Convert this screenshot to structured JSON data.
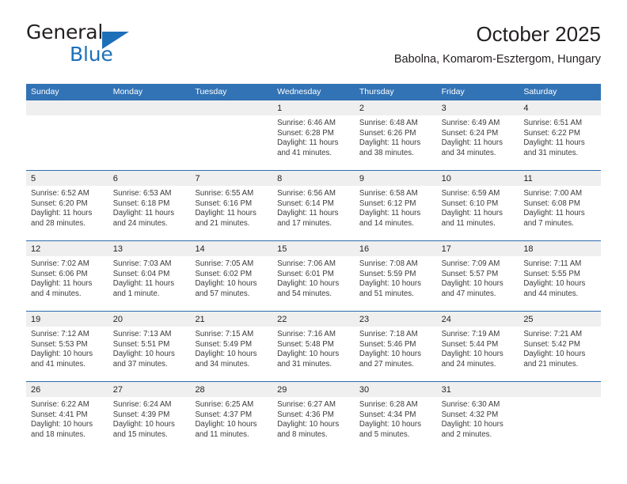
{
  "brand": {
    "name_part1": "General",
    "name_part2": "Blue",
    "triangle_icon": "triangle-icon",
    "accent_color": "#1d70b8"
  },
  "header": {
    "title": "October 2025",
    "subtitle": "Babolna, Komarom-Esztergom, Hungary"
  },
  "theme": {
    "header_blue": "#3273b5",
    "separator_blue": "#2b6cad",
    "band_gray": "#efefef",
    "text": "#231f20"
  },
  "weekdays": [
    "Sunday",
    "Monday",
    "Tuesday",
    "Wednesday",
    "Thursday",
    "Friday",
    "Saturday"
  ],
  "weeks": [
    [
      {
        "day": "",
        "sunrise": "",
        "sunset": "",
        "daylight_1": "",
        "daylight_2": ""
      },
      {
        "day": "",
        "sunrise": "",
        "sunset": "",
        "daylight_1": "",
        "daylight_2": ""
      },
      {
        "day": "",
        "sunrise": "",
        "sunset": "",
        "daylight_1": "",
        "daylight_2": ""
      },
      {
        "day": "1",
        "sunrise": "Sunrise: 6:46 AM",
        "sunset": "Sunset: 6:28 PM",
        "daylight_1": "Daylight: 11 hours",
        "daylight_2": "and 41 minutes."
      },
      {
        "day": "2",
        "sunrise": "Sunrise: 6:48 AM",
        "sunset": "Sunset: 6:26 PM",
        "daylight_1": "Daylight: 11 hours",
        "daylight_2": "and 38 minutes."
      },
      {
        "day": "3",
        "sunrise": "Sunrise: 6:49 AM",
        "sunset": "Sunset: 6:24 PM",
        "daylight_1": "Daylight: 11 hours",
        "daylight_2": "and 34 minutes."
      },
      {
        "day": "4",
        "sunrise": "Sunrise: 6:51 AM",
        "sunset": "Sunset: 6:22 PM",
        "daylight_1": "Daylight: 11 hours",
        "daylight_2": "and 31 minutes."
      }
    ],
    [
      {
        "day": "5",
        "sunrise": "Sunrise: 6:52 AM",
        "sunset": "Sunset: 6:20 PM",
        "daylight_1": "Daylight: 11 hours",
        "daylight_2": "and 28 minutes."
      },
      {
        "day": "6",
        "sunrise": "Sunrise: 6:53 AM",
        "sunset": "Sunset: 6:18 PM",
        "daylight_1": "Daylight: 11 hours",
        "daylight_2": "and 24 minutes."
      },
      {
        "day": "7",
        "sunrise": "Sunrise: 6:55 AM",
        "sunset": "Sunset: 6:16 PM",
        "daylight_1": "Daylight: 11 hours",
        "daylight_2": "and 21 minutes."
      },
      {
        "day": "8",
        "sunrise": "Sunrise: 6:56 AM",
        "sunset": "Sunset: 6:14 PM",
        "daylight_1": "Daylight: 11 hours",
        "daylight_2": "and 17 minutes."
      },
      {
        "day": "9",
        "sunrise": "Sunrise: 6:58 AM",
        "sunset": "Sunset: 6:12 PM",
        "daylight_1": "Daylight: 11 hours",
        "daylight_2": "and 14 minutes."
      },
      {
        "day": "10",
        "sunrise": "Sunrise: 6:59 AM",
        "sunset": "Sunset: 6:10 PM",
        "daylight_1": "Daylight: 11 hours",
        "daylight_2": "and 11 minutes."
      },
      {
        "day": "11",
        "sunrise": "Sunrise: 7:00 AM",
        "sunset": "Sunset: 6:08 PM",
        "daylight_1": "Daylight: 11 hours",
        "daylight_2": "and 7 minutes."
      }
    ],
    [
      {
        "day": "12",
        "sunrise": "Sunrise: 7:02 AM",
        "sunset": "Sunset: 6:06 PM",
        "daylight_1": "Daylight: 11 hours",
        "daylight_2": "and 4 minutes."
      },
      {
        "day": "13",
        "sunrise": "Sunrise: 7:03 AM",
        "sunset": "Sunset: 6:04 PM",
        "daylight_1": "Daylight: 11 hours",
        "daylight_2": "and 1 minute."
      },
      {
        "day": "14",
        "sunrise": "Sunrise: 7:05 AM",
        "sunset": "Sunset: 6:02 PM",
        "daylight_1": "Daylight: 10 hours",
        "daylight_2": "and 57 minutes."
      },
      {
        "day": "15",
        "sunrise": "Sunrise: 7:06 AM",
        "sunset": "Sunset: 6:01 PM",
        "daylight_1": "Daylight: 10 hours",
        "daylight_2": "and 54 minutes."
      },
      {
        "day": "16",
        "sunrise": "Sunrise: 7:08 AM",
        "sunset": "Sunset: 5:59 PM",
        "daylight_1": "Daylight: 10 hours",
        "daylight_2": "and 51 minutes."
      },
      {
        "day": "17",
        "sunrise": "Sunrise: 7:09 AM",
        "sunset": "Sunset: 5:57 PM",
        "daylight_1": "Daylight: 10 hours",
        "daylight_2": "and 47 minutes."
      },
      {
        "day": "18",
        "sunrise": "Sunrise: 7:11 AM",
        "sunset": "Sunset: 5:55 PM",
        "daylight_1": "Daylight: 10 hours",
        "daylight_2": "and 44 minutes."
      }
    ],
    [
      {
        "day": "19",
        "sunrise": "Sunrise: 7:12 AM",
        "sunset": "Sunset: 5:53 PM",
        "daylight_1": "Daylight: 10 hours",
        "daylight_2": "and 41 minutes."
      },
      {
        "day": "20",
        "sunrise": "Sunrise: 7:13 AM",
        "sunset": "Sunset: 5:51 PM",
        "daylight_1": "Daylight: 10 hours",
        "daylight_2": "and 37 minutes."
      },
      {
        "day": "21",
        "sunrise": "Sunrise: 7:15 AM",
        "sunset": "Sunset: 5:49 PM",
        "daylight_1": "Daylight: 10 hours",
        "daylight_2": "and 34 minutes."
      },
      {
        "day": "22",
        "sunrise": "Sunrise: 7:16 AM",
        "sunset": "Sunset: 5:48 PM",
        "daylight_1": "Daylight: 10 hours",
        "daylight_2": "and 31 minutes."
      },
      {
        "day": "23",
        "sunrise": "Sunrise: 7:18 AM",
        "sunset": "Sunset: 5:46 PM",
        "daylight_1": "Daylight: 10 hours",
        "daylight_2": "and 27 minutes."
      },
      {
        "day": "24",
        "sunrise": "Sunrise: 7:19 AM",
        "sunset": "Sunset: 5:44 PM",
        "daylight_1": "Daylight: 10 hours",
        "daylight_2": "and 24 minutes."
      },
      {
        "day": "25",
        "sunrise": "Sunrise: 7:21 AM",
        "sunset": "Sunset: 5:42 PM",
        "daylight_1": "Daylight: 10 hours",
        "daylight_2": "and 21 minutes."
      }
    ],
    [
      {
        "day": "26",
        "sunrise": "Sunrise: 6:22 AM",
        "sunset": "Sunset: 4:41 PM",
        "daylight_1": "Daylight: 10 hours",
        "daylight_2": "and 18 minutes."
      },
      {
        "day": "27",
        "sunrise": "Sunrise: 6:24 AM",
        "sunset": "Sunset: 4:39 PM",
        "daylight_1": "Daylight: 10 hours",
        "daylight_2": "and 15 minutes."
      },
      {
        "day": "28",
        "sunrise": "Sunrise: 6:25 AM",
        "sunset": "Sunset: 4:37 PM",
        "daylight_1": "Daylight: 10 hours",
        "daylight_2": "and 11 minutes."
      },
      {
        "day": "29",
        "sunrise": "Sunrise: 6:27 AM",
        "sunset": "Sunset: 4:36 PM",
        "daylight_1": "Daylight: 10 hours",
        "daylight_2": "and 8 minutes."
      },
      {
        "day": "30",
        "sunrise": "Sunrise: 6:28 AM",
        "sunset": "Sunset: 4:34 PM",
        "daylight_1": "Daylight: 10 hours",
        "daylight_2": "and 5 minutes."
      },
      {
        "day": "31",
        "sunrise": "Sunrise: 6:30 AM",
        "sunset": "Sunset: 4:32 PM",
        "daylight_1": "Daylight: 10 hours",
        "daylight_2": "and 2 minutes."
      },
      {
        "day": "",
        "sunrise": "",
        "sunset": "",
        "daylight_1": "",
        "daylight_2": ""
      }
    ]
  ]
}
